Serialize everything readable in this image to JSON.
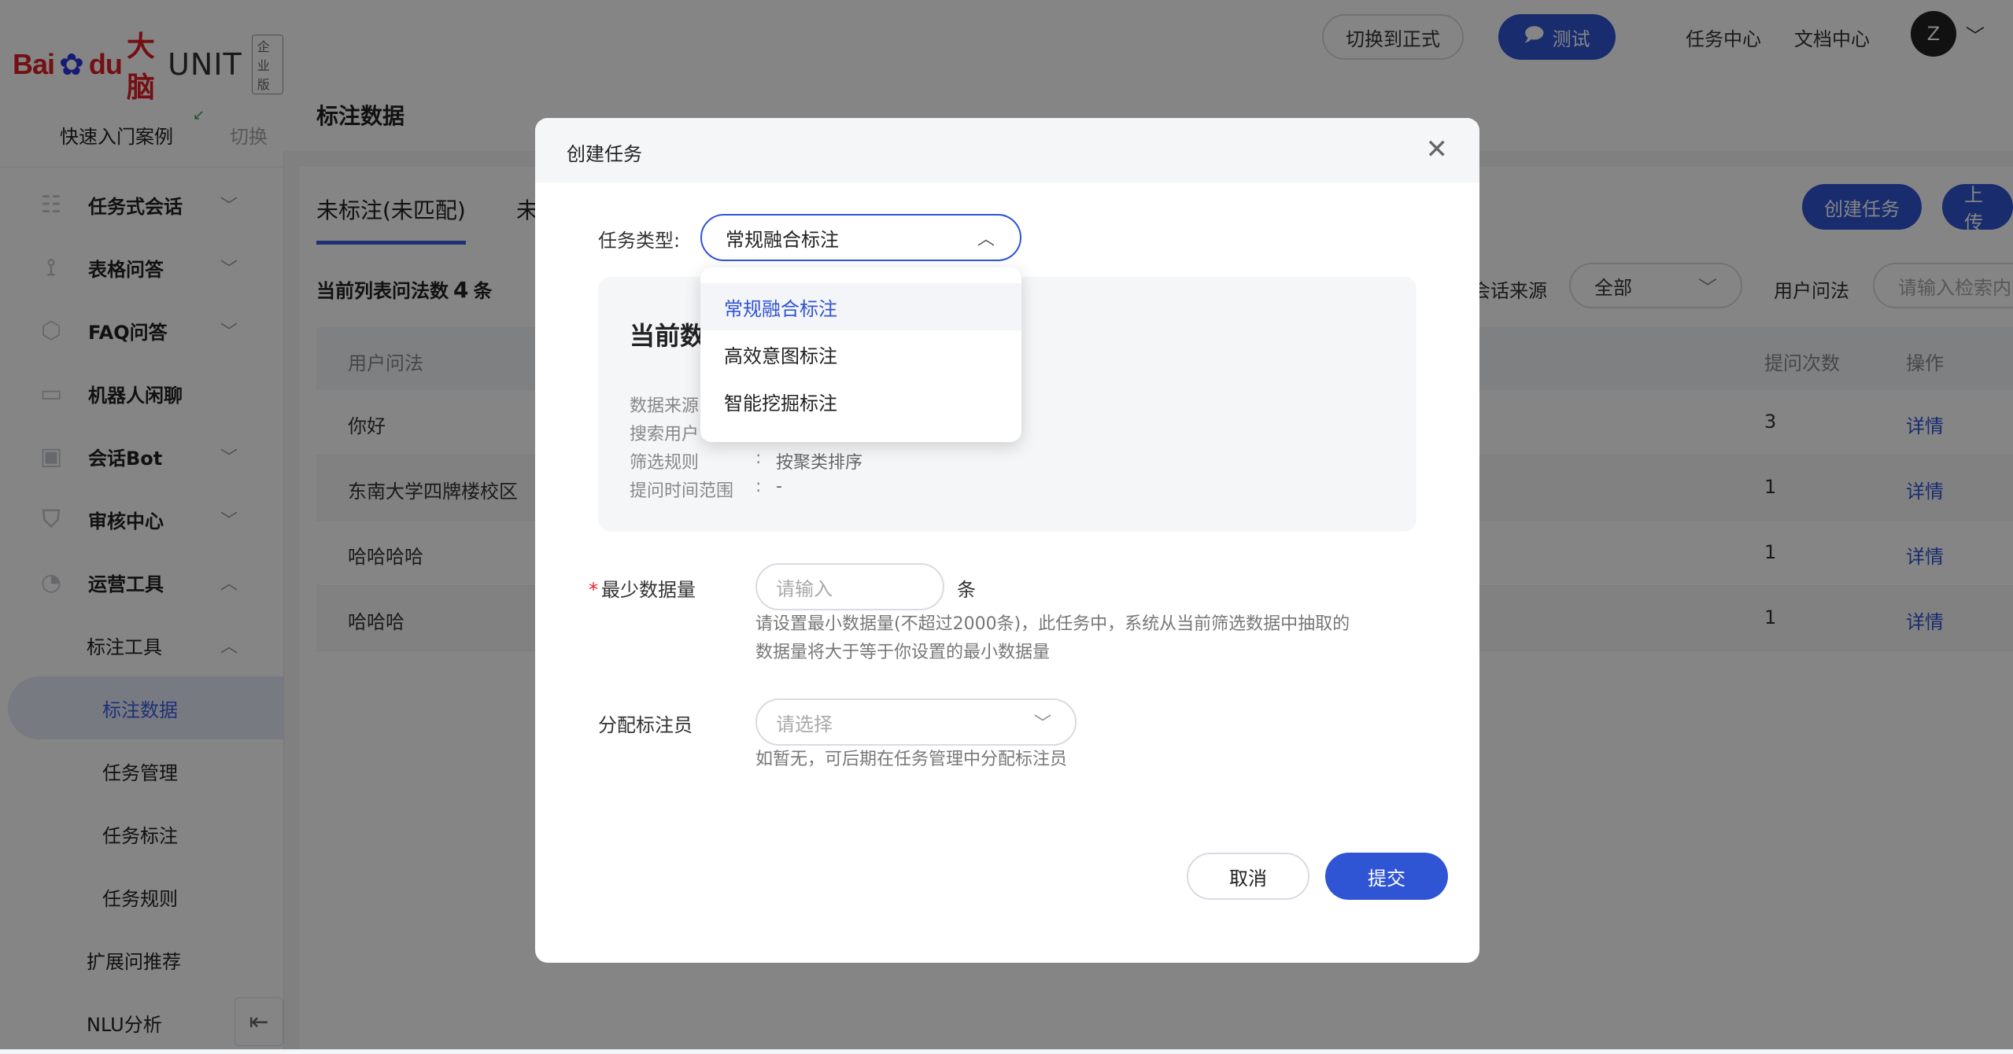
{
  "logo": {
    "brand": "Bai",
    "brand2": "du",
    "brain": "大脑",
    "product": "UNIT",
    "edition": "企业版"
  },
  "sidebar": {
    "quick_label": "快速入门案例",
    "switch_label": "切换",
    "items": [
      {
        "label": "任务式会话"
      },
      {
        "label": "表格问答"
      },
      {
        "label": "FAQ问答"
      },
      {
        "label": "机器人闲聊"
      },
      {
        "label": "会话Bot"
      },
      {
        "label": "审核中心"
      },
      {
        "label": "运营工具"
      },
      {
        "label": "标注工具"
      },
      {
        "label": "标注数据"
      },
      {
        "label": "任务管理"
      },
      {
        "label": "任务标注"
      },
      {
        "label": "任务规则"
      },
      {
        "label": "扩展问推荐"
      },
      {
        "label": "NLU分析"
      }
    ]
  },
  "topbar": {
    "switch_formal": "切换到正式",
    "test": "测试",
    "task_center": "任务中心",
    "doc_center": "文档中心",
    "avatar": "Z"
  },
  "page": {
    "title": "标注数据",
    "tab_unlabeled": "未标注(未匹配)",
    "tab_second": "未",
    "create_task": "创建任务",
    "upload": "上传",
    "count_prefix": "当前列表问法数",
    "count_value": "4",
    "count_suffix": "条",
    "source_label": "会话来源",
    "source_value": "全部",
    "query_label": "用户问法",
    "query_placeholder": "请输入检索内"
  },
  "table": {
    "headers": {
      "query": "用户问法",
      "count": "提问次数",
      "action": "操作"
    },
    "rows": [
      {
        "query": "你好",
        "count": "3",
        "action": "详情"
      },
      {
        "query": "东南大学四牌楼校区",
        "count": "1",
        "action": "详情"
      },
      {
        "query": "哈哈哈哈",
        "count": "1",
        "action": "详情"
      },
      {
        "query": "哈哈哈",
        "count": "1",
        "action": "详情"
      }
    ]
  },
  "modal": {
    "title": "创建任务",
    "task_type_label": "任务类型:",
    "task_type_value": "常规融合标注",
    "info_title": "当前数",
    "info": [
      {
        "label": "数据来源",
        "sep": "",
        "value": ""
      },
      {
        "label": "搜索用户",
        "sep": "",
        "value": ""
      },
      {
        "label": "筛选规则",
        "sep": ":",
        "value": "按聚类排序"
      },
      {
        "label": "提问时间范围",
        "sep": ":",
        "value": "-"
      }
    ],
    "dropdown_options": [
      "常规融合标注",
      "高效意图标注",
      "智能挖掘标注"
    ],
    "min_label": "最少数据量",
    "min_required": "*",
    "min_placeholder": "请输入",
    "min_unit": "条",
    "min_hint_1": "请设置最小数据量(不超过2000条)，此任务中，系统从当前筛选数据中抽取的",
    "min_hint_2": "数据量将大于等于你设置的最小数据量",
    "assign_label": "分配标注员",
    "assign_placeholder": "请选择",
    "assign_hint": "如暂无，可后期在任务管理中分配标注员",
    "cancel": "取消",
    "submit": "提交"
  },
  "colors": {
    "primary": "#2f55d4",
    "overlay": "rgba(0,0,0,0.48)"
  }
}
